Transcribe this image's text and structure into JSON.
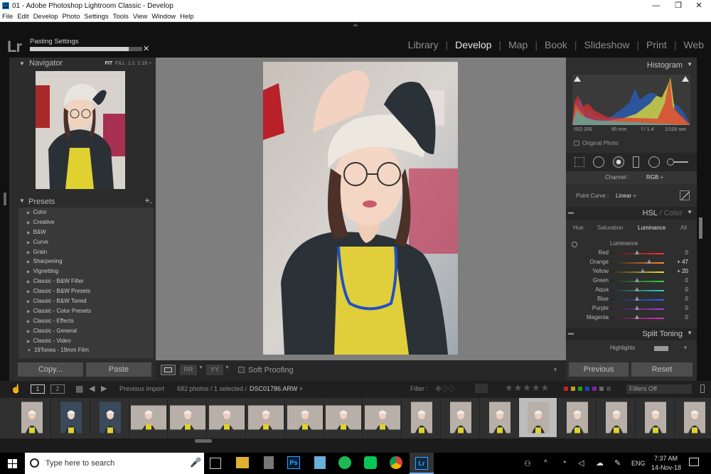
{
  "window": {
    "title": "01 - Adobe Photoshop Lightroom Classic - Develop",
    "icon": "Lr",
    "controls": [
      "—",
      "❐",
      "✕"
    ]
  },
  "menu": [
    "File",
    "Edit",
    "Develop",
    "Photo",
    "Settings",
    "Tools",
    "View",
    "Window",
    "Help"
  ],
  "header": {
    "logo": "Lr",
    "status_label": "Pasting Settings",
    "progress_percent": 88,
    "close_glyph": "✕",
    "modules": [
      "Library",
      "Develop",
      "Map",
      "Book",
      "Slideshow",
      "Print",
      "Web"
    ],
    "active_module": "Develop"
  },
  "navigator": {
    "title": "Navigator",
    "options": [
      "FIT",
      "FILL",
      "1:1",
      "1:16 ÷"
    ]
  },
  "presets": {
    "title": "Presets",
    "add": "+.",
    "items": [
      "Color",
      "Creative",
      "B&W",
      "Curve",
      "Grain",
      "Sharpening",
      "Vignetting",
      "Classic - B&W Filter",
      "Classic - B&W Presets",
      "Classic - B&W Toned",
      "Classic - Color Presets",
      "Classic - Effects",
      "Classic - General",
      "Classic - Video",
      "19Tones - 19mm Film"
    ],
    "expanded_item": "19Tones - 19mm Film"
  },
  "left_buttons": {
    "copy": "Copy...",
    "paste": "Paste"
  },
  "toolbar": {
    "soft_proofing": "Soft Proofing"
  },
  "histogram": {
    "title": "Histogram",
    "iso": "ISO 200",
    "focal": "85 mm",
    "aperture": "f / 1.4",
    "shutter": "1/100 sec",
    "original_photo": "Original Photo"
  },
  "tone_curve": {
    "channel_label": "Channel :",
    "channel_value": "RGB ÷",
    "point_curve_label": "Point Curve :",
    "point_curve_value": "Linear ÷"
  },
  "hsl": {
    "title_main": "HSL",
    "title_sep": " / ",
    "title_alt": "Color",
    "tabs": [
      "Hue",
      "Saturation",
      "Luminance",
      "All"
    ],
    "active_tab": "Luminance",
    "section": "Luminance",
    "rows": [
      {
        "label": "Red",
        "value": "0",
        "pos": 0.5,
        "grad": "#ff3030"
      },
      {
        "label": "Orange",
        "value": "+ 47",
        "pos": 0.73,
        "grad": "#ff9020"
      },
      {
        "label": "Yellow",
        "value": "+ 20",
        "pos": 0.6,
        "grad": "#f0e020"
      },
      {
        "label": "Green",
        "value": "0",
        "pos": 0.5,
        "grad": "#30d040"
      },
      {
        "label": "Aqua",
        "value": "0",
        "pos": 0.5,
        "grad": "#30d0d0"
      },
      {
        "label": "Blue",
        "value": "0",
        "pos": 0.5,
        "grad": "#3060ff"
      },
      {
        "label": "Purple",
        "value": "0",
        "pos": 0.5,
        "grad": "#a040e0"
      },
      {
        "label": "Magenta",
        "value": "0",
        "pos": 0.5,
        "grad": "#e030c0"
      }
    ]
  },
  "split_toning": {
    "title": "Split Toning",
    "highlights": "Highlights"
  },
  "right_buttons": {
    "previous": "Previous",
    "reset": "Reset"
  },
  "filmstrip_bar": {
    "pages": [
      "1",
      "2"
    ],
    "source": "Previous Import",
    "count": "682 photos / 1 selected /",
    "filename": "DSC01786.ARW ÷",
    "filter_label": "Filter :",
    "filters_off": "Filters Off"
  },
  "filmstrip": {
    "thumb_count": 18,
    "selected_index": 13
  },
  "taskbar": {
    "search_placeholder": "Type here to search",
    "lang": "ENG",
    "time": "7:37 AM",
    "date": "14-Nov-18",
    "apps": [
      "task-view",
      "file-explorer",
      "calculator",
      "photoshop",
      "notes",
      "spotify",
      "line",
      "chrome",
      "lightroom"
    ]
  },
  "colors": {
    "accent": "#31a8ff",
    "panel": "#2c2c2c",
    "active_text": "#e8e8e8"
  }
}
